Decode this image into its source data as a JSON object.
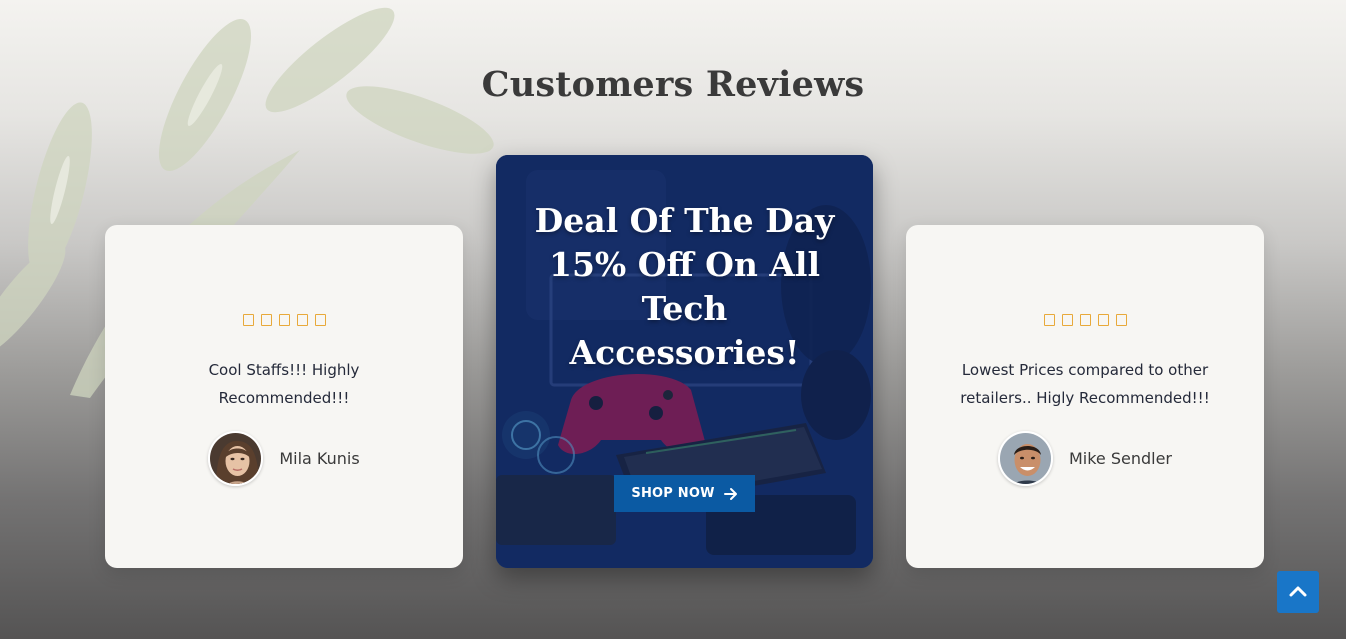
{
  "section": {
    "title": "Customers Reviews"
  },
  "reviews": [
    {
      "stars": 5,
      "text": "Cool Staffs!!! Highly Recommended!!!",
      "name": "Mila Kunis",
      "avatar": "female-avatar"
    },
    {
      "stars": 5,
      "text": "Lowest Prices compared to other retailers.. Higly Recommended!!!",
      "name": "Mike Sendler",
      "avatar": "male-avatar"
    }
  ],
  "promo": {
    "title": "Deal Of The Day 15% Off On All Tech Accessories!",
    "button_label": "SHOP NOW",
    "button_icon": "arrow-right-icon"
  },
  "scroll_top": {
    "icon": "chevron-up-icon"
  },
  "colors": {
    "star": "#e8a93a",
    "button": "#0b5aa3",
    "scroll_top": "#1976c8",
    "promo_bg": "#13306c"
  }
}
